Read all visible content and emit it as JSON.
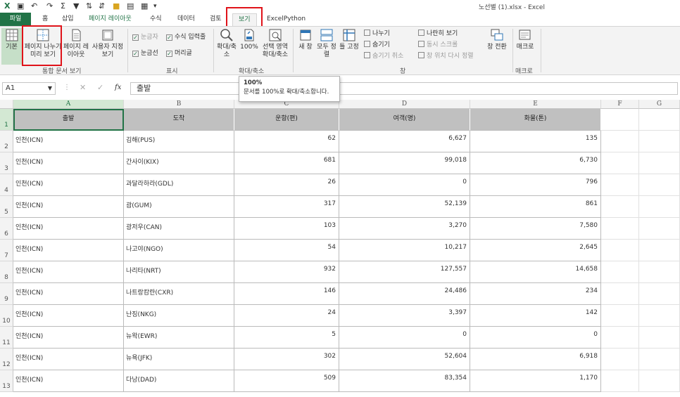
{
  "window": {
    "title": "노선별 (1).xlsx - Excel"
  },
  "tabs": [
    "파일",
    "홈",
    "삽입",
    "페이지 레이아웃",
    "수식",
    "데이터",
    "검토",
    "보기",
    "ExcelPython"
  ],
  "active_tab": "보기",
  "ribbon": {
    "workbook_views": {
      "normal": "기본",
      "page_break": "페이지 나누기 미리 보기",
      "page_layout": "페이지 레이아웃",
      "custom": "사용자 지정 보기",
      "group": "통합 문서 보기"
    },
    "show": {
      "ruler": "눈금자",
      "formula_bar": "수식 입력줄",
      "gridlines": "눈금선",
      "headings": "머리글",
      "group": "표시"
    },
    "zoom": {
      "zoom": "확대/축소",
      "zoom100": "100%",
      "selection": "선택 영역 확대/축소",
      "group": "확대/축소"
    },
    "window": {
      "new": "새 창",
      "arrange": "모두 정렬",
      "freeze": "틀 고정",
      "split": "나누기",
      "hide": "숨기기",
      "unhide": "숨기기 취소",
      "side": "나란히 보기",
      "sync": "동시 스크롤",
      "reset": "창 위치 다시 정렬",
      "switch": "창 전환",
      "group": "창"
    },
    "macros": {
      "label": "매크로",
      "group": "매크로"
    }
  },
  "tooltip": {
    "title": "100%",
    "desc": "문서를 100%로 확대/축소합니다."
  },
  "formula_bar": {
    "name_box": "A1",
    "fx": "fx",
    "content": "출발"
  },
  "columns": [
    "A",
    "B",
    "C",
    "D",
    "E",
    "F",
    "G"
  ],
  "headers": [
    "출발",
    "도착",
    "운항(편)",
    "여객(명)",
    "화물(톤)"
  ],
  "rows": [
    [
      "인천(ICN)",
      "김해(PUS)",
      "62",
      "6,627",
      "135"
    ],
    [
      "인천(ICN)",
      "간사이(KIX)",
      "681",
      "99,018",
      "6,730"
    ],
    [
      "인천(ICN)",
      "과달라하라(GDL)",
      "26",
      "0",
      "796"
    ],
    [
      "인천(ICN)",
      "괌(GUM)",
      "317",
      "52,139",
      "861"
    ],
    [
      "인천(ICN)",
      "광저우(CAN)",
      "103",
      "3,270",
      "7,580"
    ],
    [
      "인천(ICN)",
      "나고야(NGO)",
      "54",
      "10,217",
      "2,645"
    ],
    [
      "인천(ICN)",
      "나리타(NRT)",
      "932",
      "127,557",
      "14,658"
    ],
    [
      "인천(ICN)",
      "나트랑캄란(CXR)",
      "146",
      "24,486",
      "234"
    ],
    [
      "인천(ICN)",
      "난징(NKG)",
      "24",
      "3,397",
      "142"
    ],
    [
      "인천(ICN)",
      "뉴왁(EWR)",
      "5",
      "0",
      "0"
    ],
    [
      "인천(ICN)",
      "뉴욕(JFK)",
      "302",
      "52,604",
      "6,918"
    ],
    [
      "인천(ICN)",
      "다낭(DAD)",
      "509",
      "83,354",
      "1,170"
    ]
  ]
}
